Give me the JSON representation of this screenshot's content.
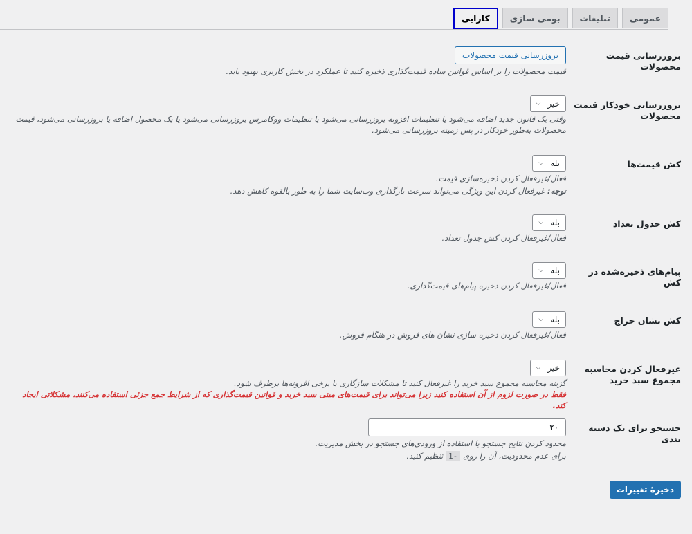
{
  "tabs": [
    {
      "label": "عمومی"
    },
    {
      "label": "تبلیغات"
    },
    {
      "label": "بومی سازی"
    },
    {
      "label": "کارایی"
    }
  ],
  "rows": {
    "update_prices": {
      "label": "بروزرسانی قیمت محصولات",
      "button": "بروزرسانی قیمت محصولات",
      "desc": "قیمت محصولات را بر اساس قوانین ساده قیمت‌گذاری ذخیره کنید تا عملکرد در بخش کاربری بهبود یابد."
    },
    "auto_update": {
      "label": "بروزرسانی خودکار قیمت محصولات",
      "value": "خیر",
      "desc": "وقتی یک قانون جدید اضافه می‌شود یا تنظیمات افزونه بروزرسانی می‌شود یا تنظیمات ووکامرس بروزرسانی می‌شود یا یک محصول اضافه یا بروزرسانی می‌شود، قیمت محصولات به‌طور خودکار در پس زمینه بروزرسانی می‌شود."
    },
    "price_cache": {
      "label": "کش قیمت‌ها",
      "value": "بله",
      "desc": "فعال/غیرفعال کردن ذخیره‌سازی قیمت.",
      "note_label": "توجه:",
      "note": " غیرفعال کردن این ویژگی می‌تواند سرعت بارگذاری وب‌سایت شما را به طور بالقوه کاهش دهد."
    },
    "qty_table_cache": {
      "label": "کش جدول تعداد",
      "value": "بله",
      "desc": "فعال/غیرفعال کردن کش جدول تعداد."
    },
    "messages_cache": {
      "label": "پیام‌های ذخیره‌شده در کش",
      "value": "بله",
      "desc": "فعال/غیرفعال کردن ذخیره پیام‌های قیمت‌گذاری."
    },
    "sale_badge_cache": {
      "label": "کش نشان حراج",
      "value": "بله",
      "desc": "فعال/غیرفعال کردن ذخیره سازی نشان های فروش در هنگام فروش."
    },
    "disable_cart_total": {
      "label": "غیرفعال کردن محاسبه مجموع سبد خرید",
      "value": "خیر",
      "desc": "گزینه محاسبه مجموع سبد خرید را غیرفعال کنید تا مشکلات سازگاری با برخی افزونه‌ها برطرف شود.",
      "warning": "فقط در صورت لزوم از آن استفاده کنید زیرا می‌تواند برای قیمت‌های مبنی سبد خرید و قوانین قیمت‌گذاری که از شرایط جمع جزئی استفاده می‌کنند، مشکلاتی ایجاد کند."
    },
    "search_limit": {
      "label": "جستجو برای یک دسته بندی",
      "value": "۲۰",
      "desc": "محدود کردن نتایج جستجو با استفاده از ورودی‌های جستجو در بخش مدیریت.",
      "desc2_a": "برای عدم محدودیت، آن را روی ",
      "code": "-1",
      "desc2_b": " تنظیم کنید."
    }
  },
  "save_label": "ذخیرهٔ تغییرات"
}
